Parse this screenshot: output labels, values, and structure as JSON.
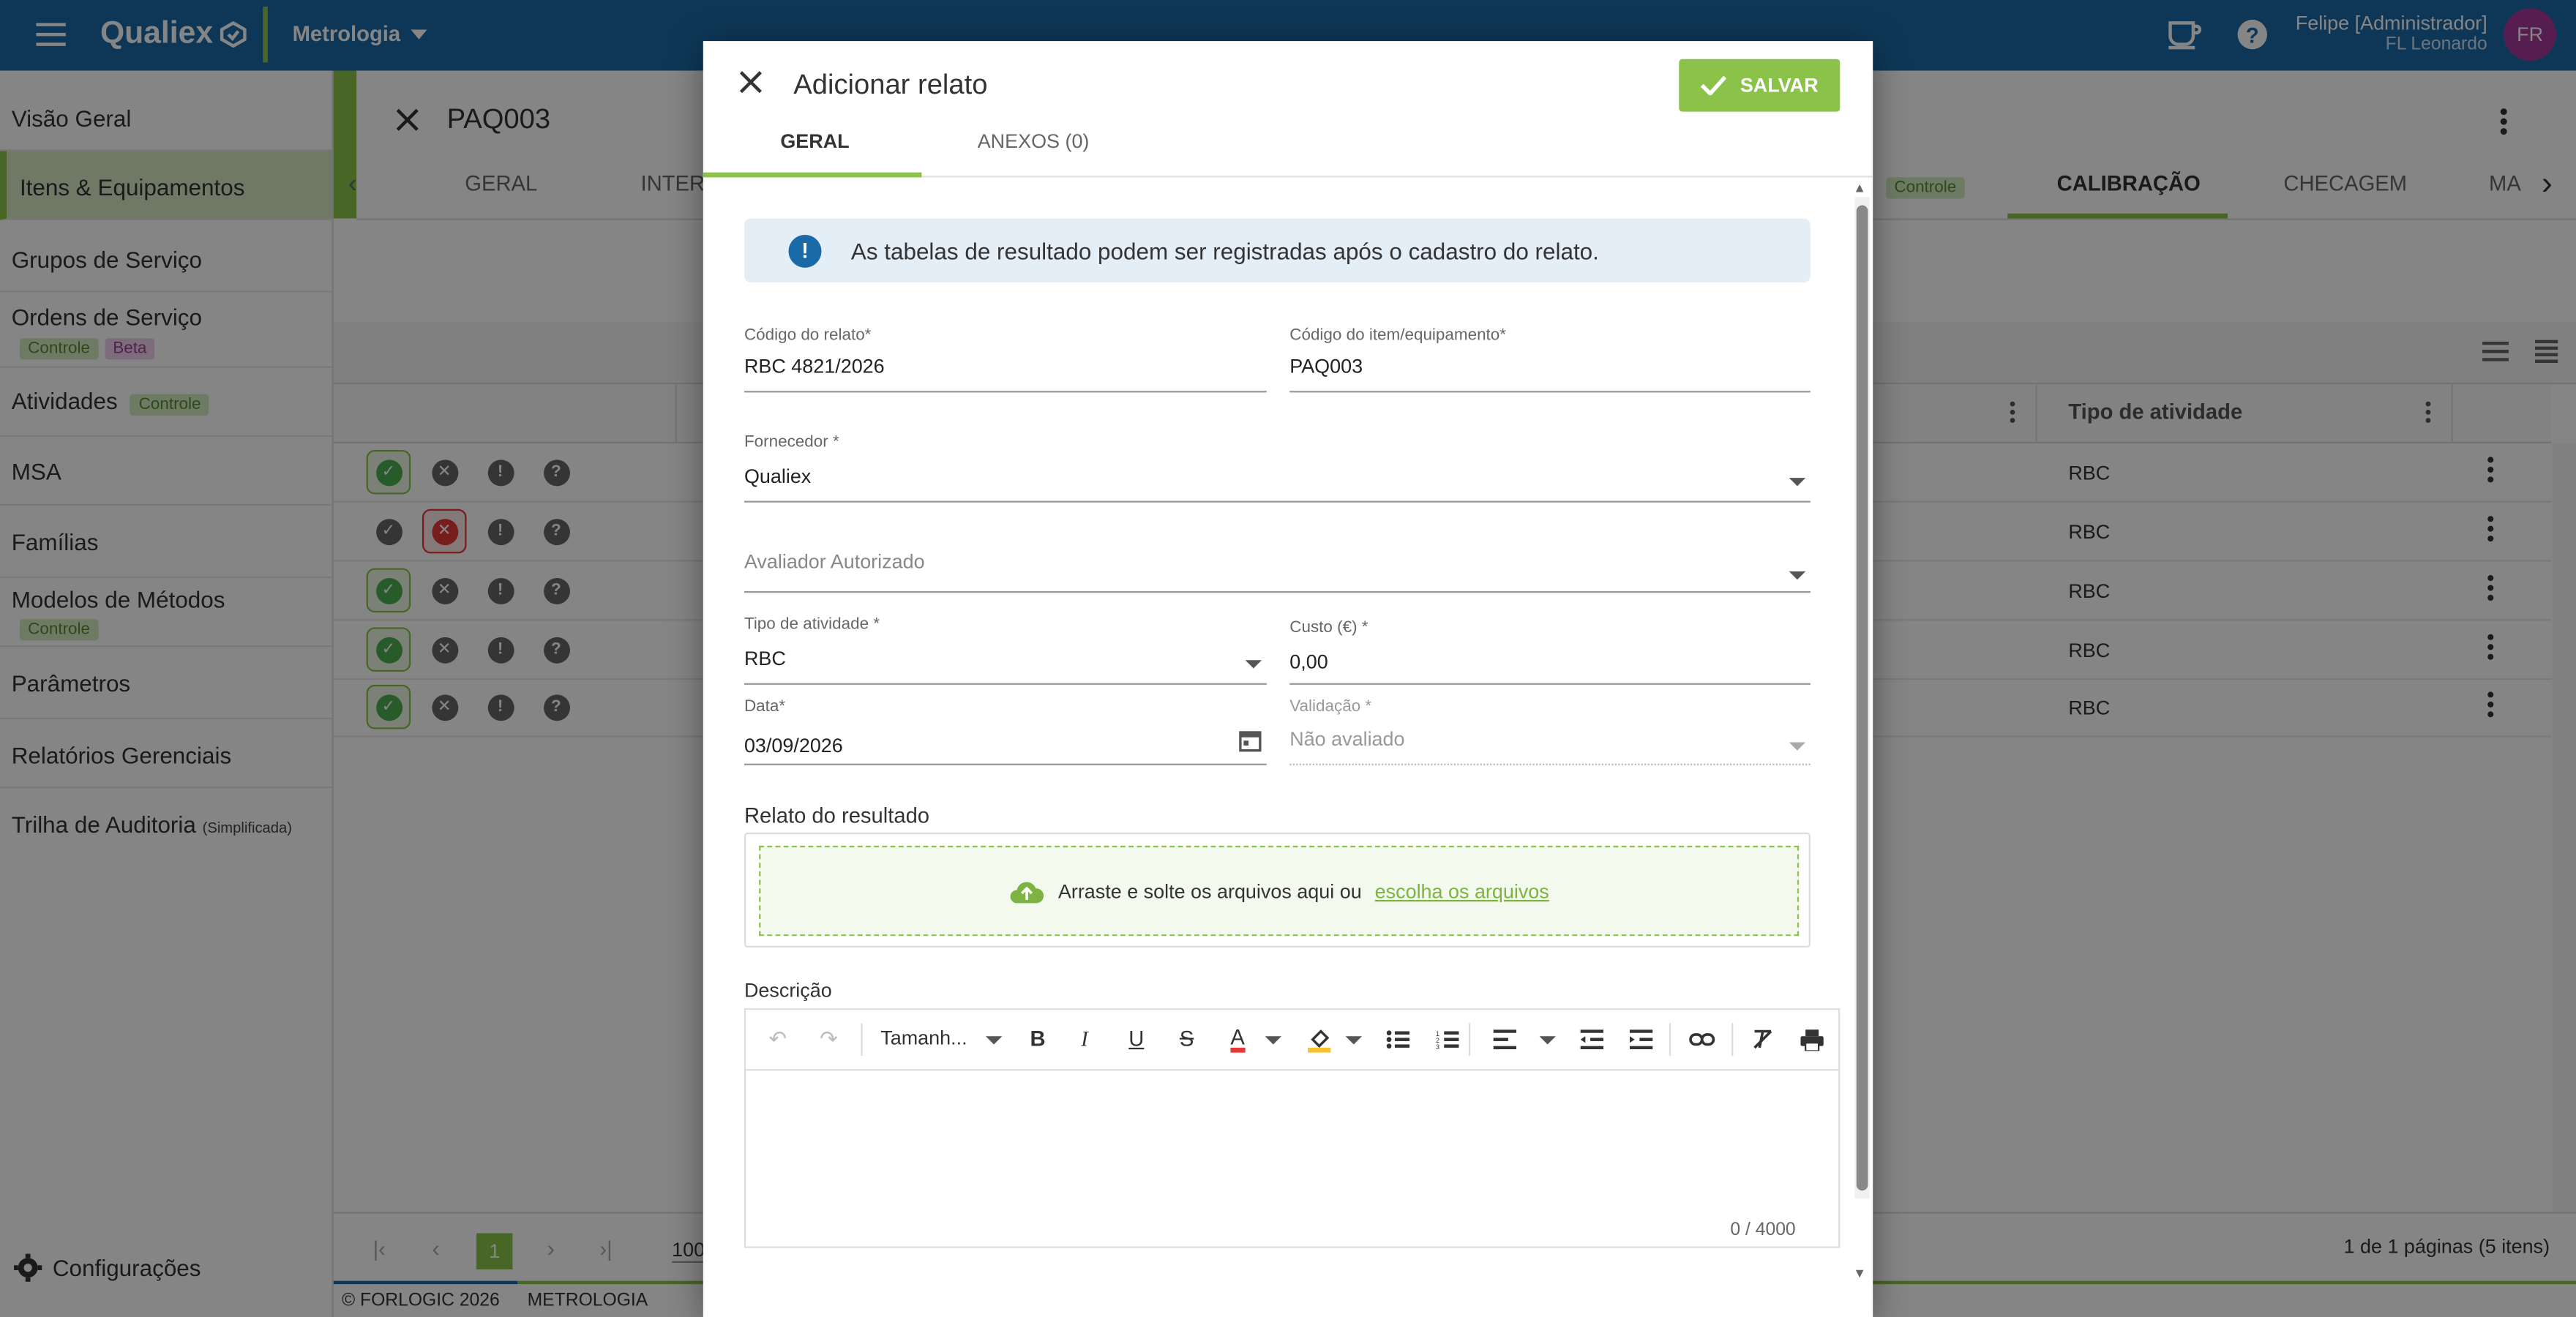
{
  "topbar": {
    "brand": "Qualiex",
    "module": "Metrologia",
    "user_name": "Felipe [Administrador]",
    "user_company": "FL Leonardo",
    "avatar_initials": "FR"
  },
  "sidebar": {
    "items": [
      {
        "label": "Visão Geral"
      },
      {
        "label": "Itens & Equipamentos"
      },
      {
        "label": "Grupos de Serviço"
      },
      {
        "label": "Ordens de Serviço",
        "tags": [
          "Controle",
          "Beta"
        ]
      },
      {
        "label": "Atividades",
        "tags": [
          "Controle"
        ]
      },
      {
        "label": "MSA"
      },
      {
        "label": "Famílias"
      },
      {
        "label": "Modelos de Métodos",
        "tags": [
          "Controle"
        ]
      },
      {
        "label": "Parâmetros"
      },
      {
        "label": "Relatórios Gerenciais"
      },
      {
        "label": "Trilha de Auditoria",
        "suffix": "(Simplificada)"
      }
    ],
    "config_label": "Configurações"
  },
  "record": {
    "title": "PAQ003",
    "tabs": [
      "GERAL",
      "INTER",
      "Controle",
      "CALIBRAÇÃO",
      "CHECAGEM",
      "MA"
    ],
    "grid_header_type": "Tipo de atividade",
    "rows": [
      "RBC",
      "RBC",
      "RBC",
      "RBC",
      "RBC"
    ],
    "pagination": {
      "page": "1",
      "per_page": "100",
      "summary": "1 de 1 páginas (5 itens)"
    },
    "footer_copyright": "© FORLOGIC 2026",
    "footer_module": "METROLOGIA"
  },
  "modal": {
    "title": "Adicionar relato",
    "save_label": "SALVAR",
    "tabs": [
      "GERAL",
      "ANEXOS (0)"
    ],
    "info_text": "As tabelas de resultado podem ser registradas após o cadastro do relato.",
    "fields": {
      "codigo_relato": {
        "label": "Código do relato*",
        "value": "RBC 4821/2026"
      },
      "codigo_item": {
        "label": "Código do item/equipamento*",
        "value": "PAQ003"
      },
      "fornecedor": {
        "label": "Fornecedor *",
        "value": "Qualiex"
      },
      "avaliador": {
        "placeholder": "Avaliador Autorizado"
      },
      "tipo_atividade": {
        "label": "Tipo de atividade *",
        "value": "RBC"
      },
      "custo": {
        "label": "Custo (€) *",
        "value": "0,00"
      },
      "data": {
        "label": "Data*",
        "value": "03/09/2026"
      },
      "validacao": {
        "label": "Validação *",
        "value": "Não avaliado"
      }
    },
    "relato_label": "Relato do resultado",
    "drop_text": "Arraste e solte os arquivos aqui ou",
    "drop_link": "escolha os arquivos",
    "descricao_label": "Descrição",
    "font_size_label": "Tamanh...",
    "counter": "0 / 4000"
  },
  "colors": {
    "primary": "#1b6aa8",
    "accent": "#8bc34a",
    "avatar": "#a53a9a"
  }
}
